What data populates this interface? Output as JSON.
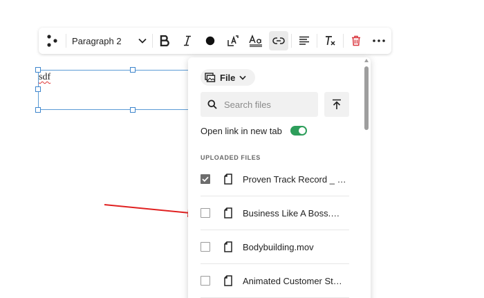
{
  "toolbar": {
    "paragraph_style": "Paragraph 2",
    "icons": [
      "more-dots-icon",
      "chevron-down-icon",
      "bold-icon",
      "italic-icon",
      "color-dot-icon",
      "text-size-icon",
      "text-style-icon",
      "link-icon",
      "align-icon",
      "clear-format-icon",
      "trash-icon",
      "ellipsis-icon"
    ]
  },
  "canvas": {
    "text": "sdf"
  },
  "panel": {
    "file_label": "File",
    "search_placeholder": "Search files",
    "toggle_label": "Open link in new tab",
    "toggle_on": true,
    "section_label": "UPLOADED FILES",
    "files": [
      {
        "name": "Proven Track Record _ Si...",
        "checked": true
      },
      {
        "name": "Business Like A Boss.mov",
        "checked": false
      },
      {
        "name": "Bodybuilding.mov",
        "checked": false
      },
      {
        "name": "Animated Customer Stori...",
        "checked": false
      }
    ]
  },
  "colors": {
    "toggle": "#2e9e5b",
    "delete": "#d9363e",
    "arrow": "#e02020",
    "selection": "#3c84cc"
  }
}
